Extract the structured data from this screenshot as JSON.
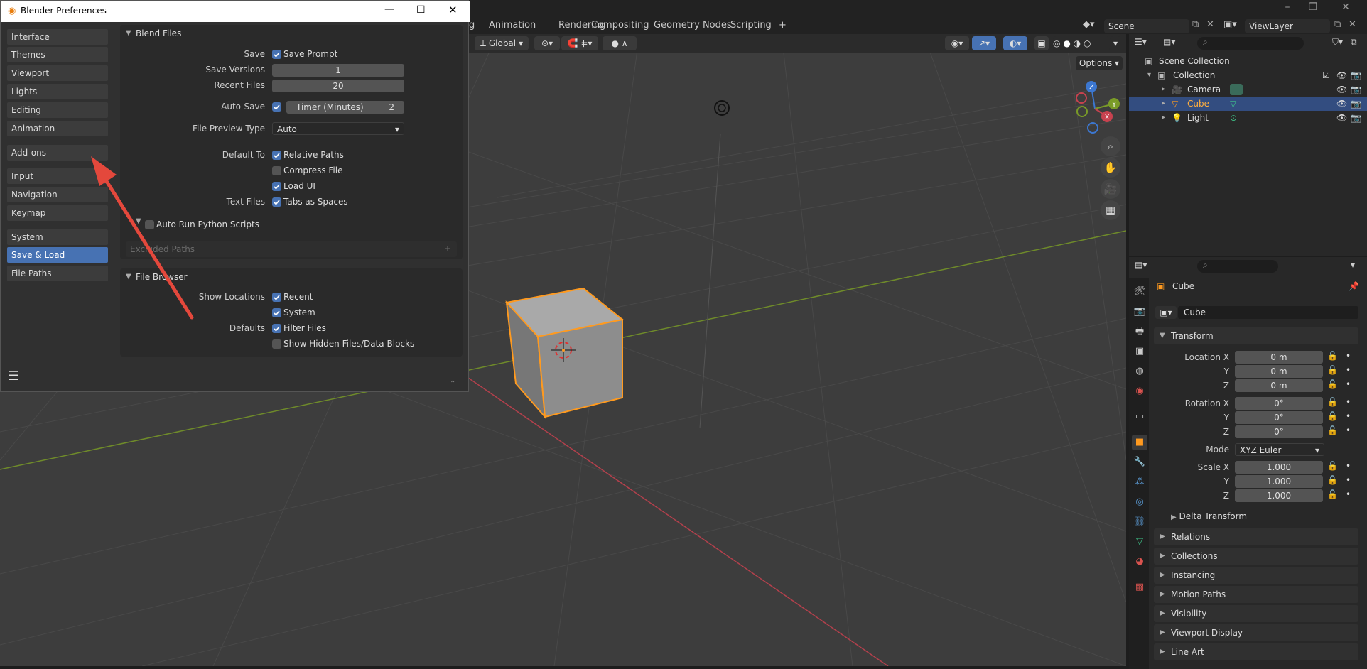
{
  "workspace_tabs": [
    "g",
    "Animation",
    "Rendering",
    "Compositing",
    "Geometry Nodes",
    "Scripting",
    "+"
  ],
  "scene_name": "Scene",
  "view_layer": "ViewLayer",
  "viewport": {
    "orientation": "Global",
    "options_label": "Options",
    "gizmo": {
      "z": "Z",
      "y": "Y",
      "x": "X"
    }
  },
  "outliner": {
    "rows": [
      {
        "label": "Scene Collection",
        "icon": "scene-collection-icon"
      },
      {
        "label": "Collection",
        "icon": "collection-icon"
      },
      {
        "label": "Camera",
        "icon": "camera-icon"
      },
      {
        "label": "Cube",
        "icon": "mesh-icon"
      },
      {
        "label": "Light",
        "icon": "light-icon"
      }
    ]
  },
  "properties": {
    "object_name": "Cube",
    "object_field": "Cube",
    "transform_header": "Transform",
    "location_label": "Location X",
    "rotation_label": "Rotation X",
    "scale_label": "Scale X",
    "y_label": "Y",
    "z_label": "Z",
    "mode_label": "Mode",
    "location": [
      "0 m",
      "0 m",
      "0 m"
    ],
    "rotation": [
      "0°",
      "0°",
      "0°"
    ],
    "mode": "XYZ Euler",
    "scale": [
      "1.000",
      "1.000",
      "1.000"
    ],
    "delta": "Delta Transform",
    "panels": [
      "Relations",
      "Collections",
      "Instancing",
      "Motion Paths",
      "Visibility",
      "Viewport Display",
      "Line Art"
    ]
  },
  "prefs": {
    "title": "Blender Preferences",
    "categories": [
      {
        "label": "Interface"
      },
      {
        "label": "Themes"
      },
      {
        "label": "Viewport"
      },
      {
        "label": "Lights"
      },
      {
        "label": "Editing"
      },
      {
        "label": "Animation"
      },
      {
        "label": "Add-ons"
      },
      {
        "label": "Input"
      },
      {
        "label": "Navigation"
      },
      {
        "label": "Keymap"
      },
      {
        "label": "System"
      },
      {
        "label": "Save & Load"
      },
      {
        "label": "File Paths"
      }
    ],
    "blend_files": {
      "header": "Blend Files",
      "save_label": "Save",
      "save_prompt": "Save Prompt",
      "save_versions_label": "Save Versions",
      "save_versions": "1",
      "recent_files_label": "Recent Files",
      "recent_files": "20",
      "autosave_label": "Auto-Save",
      "timer_label": "Timer (Minutes)",
      "timer_value": "2",
      "preview_type_label": "File Preview Type",
      "preview_type": "Auto",
      "default_to_label": "Default To",
      "relative_paths": "Relative Paths",
      "compress_file": "Compress File",
      "load_ui": "Load UI",
      "text_files_label": "Text Files",
      "tabs_as_spaces": "Tabs as Spaces"
    },
    "auto_run": {
      "label": "Auto Run Python Scripts",
      "excluded_paths": "Excluded Paths",
      "add": "+"
    },
    "file_browser": {
      "header": "File Browser",
      "show_locations_label": "Show Locations",
      "recent": "Recent",
      "system": "System",
      "defaults_label": "Defaults",
      "filter_files": "Filter Files",
      "show_hidden": "Show Hidden Files/Data-Blocks"
    }
  },
  "colors": {
    "accent": "#4772b3",
    "selected_orange": "#ff9a1f",
    "x_axis": "#c8424f",
    "y_axis": "#7a9b27"
  }
}
